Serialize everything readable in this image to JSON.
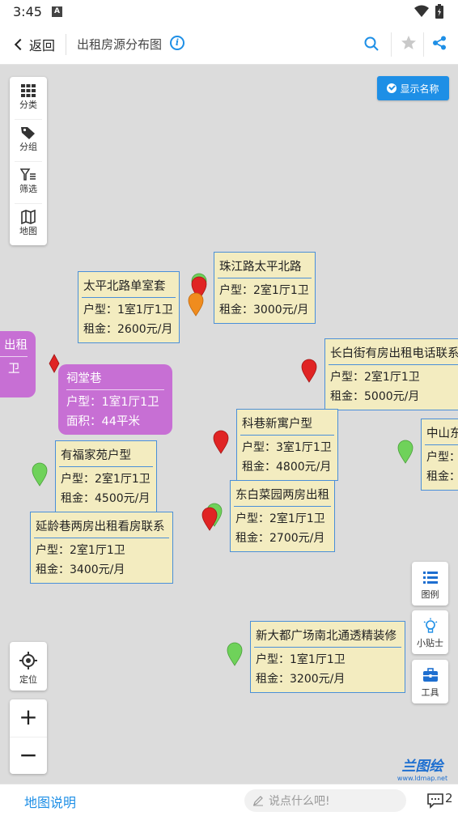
{
  "status_bar": {
    "time": "3:45",
    "a_badge": "A"
  },
  "header": {
    "back_label": "返回",
    "title": "出租房源分布图",
    "info_icon_glyph": "i"
  },
  "map": {
    "show_names_label": "显示名称",
    "left_toolbar": [
      {
        "label": "分类",
        "icon": "grid-icon"
      },
      {
        "label": "分组",
        "icon": "tag-icon"
      },
      {
        "label": "筛选",
        "icon": "filter-icon"
      },
      {
        "label": "地图",
        "icon": "map-icon"
      }
    ],
    "cards": [
      {
        "title": "太平北路单室套",
        "row1": "户型：1室1厅1卫",
        "row2": "租金：2600元/月"
      },
      {
        "title": "珠江路太平北路",
        "row1": "户型：2室1厅1卫",
        "row2": "租金：3000元/月"
      },
      {
        "title": "长白街有房出租电话联系",
        "row1": "户型：2室1厅1卫",
        "row2": "租金：5000元/月"
      },
      {
        "title": "科巷新寓户型",
        "row1": "户型：3室1厅1卫",
        "row2": "租金：4800元/月"
      },
      {
        "title": "有福家苑户型",
        "row1": "户型：2室1厅1卫",
        "row2": "租金：4500元/月"
      },
      {
        "title": "东白菜园两房出租",
        "row1": "户型：2室1厅1卫",
        "row2": "租金：2700元/月"
      },
      {
        "title": "延龄巷两房出租看房联系",
        "row1": "户型：2室1厅1卫",
        "row2": "租金：3400元/月"
      },
      {
        "title": "中山东",
        "row1": "户型：",
        "row2": "租金："
      },
      {
        "title": "新大都广场南北通透精装修",
        "row1": "户型：1室1厅1卫",
        "row2": "租金：3200元/月"
      }
    ],
    "purple_cards": [
      {
        "title": "祠堂巷",
        "row1": "户型：1室1厅1卫",
        "row2": "面积：44平米"
      },
      {
        "title": "出租",
        "row1": "卫"
      }
    ],
    "right_toolbar": [
      {
        "label": "图例",
        "icon": "list-icon"
      },
      {
        "label": "小贴士",
        "icon": "lightbulb-icon"
      },
      {
        "label": "工具",
        "icon": "toolbox-icon"
      }
    ],
    "locate_label": "定位",
    "zoom_in": "+",
    "zoom_out": "−",
    "logo_name": "兰图绘",
    "logo_url": "www.ldmap.net"
  },
  "bottom_bar": {
    "map_desc": "地图说明",
    "comment_placeholder": "说点什么吧!",
    "comment_count": "2"
  },
  "colors": {
    "accent": "#1e8fe6",
    "card_bg": "#f3ecc0",
    "card_border": "#4a8fd8",
    "purple": "#c76fd4",
    "marker_red": "#e02424",
    "marker_green": "#6fd25a",
    "marker_orange": "#f08c1e"
  }
}
